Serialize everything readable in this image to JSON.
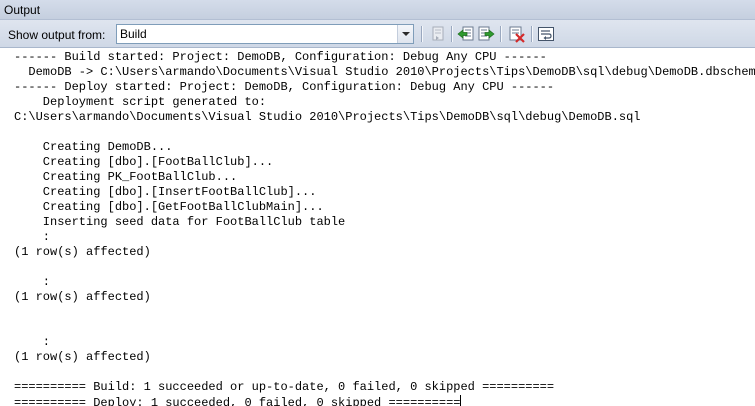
{
  "window": {
    "title": "Output"
  },
  "toolbar": {
    "show_output_label": "Show output from:",
    "source_select": {
      "selected": "Build"
    },
    "buttons": [
      {
        "name": "go-to-line-icon"
      },
      {
        "name": "find-previous-message-icon"
      },
      {
        "name": "find-next-message-icon"
      },
      {
        "name": "clear-all-icon"
      },
      {
        "name": "toggle-word-wrap-icon"
      }
    ]
  },
  "output": {
    "lines": [
      "------ Build started: Project: DemoDB, Configuration: Debug Any CPU ------",
      "  DemoDB -> C:\\Users\\armando\\Documents\\Visual Studio 2010\\Projects\\Tips\\DemoDB\\sql\\debug\\DemoDB.dbschema",
      "------ Deploy started: Project: DemoDB, Configuration: Debug Any CPU ------",
      "    Deployment script generated to:",
      "C:\\Users\\armando\\Documents\\Visual Studio 2010\\Projects\\Tips\\DemoDB\\sql\\debug\\DemoDB.sql",
      "",
      "    Creating DemoDB...",
      "    Creating [dbo].[FootBallClub]...",
      "    Creating PK_FootBallClub...",
      "    Creating [dbo].[InsertFootBallClub]...",
      "    Creating [dbo].[GetFootBallClubMain]...",
      "    Inserting seed data for FootBallClub table",
      "    :",
      "(1 row(s) affected)",
      "",
      "    :",
      "(1 row(s) affected)",
      "",
      "",
      "    :",
      "(1 row(s) affected)",
      "",
      "========== Build: 1 succeeded or up-to-date, 0 failed, 0 skipped ==========",
      "========== Deploy: 1 succeeded, 0 failed, 0 skipped =========="
    ]
  }
}
